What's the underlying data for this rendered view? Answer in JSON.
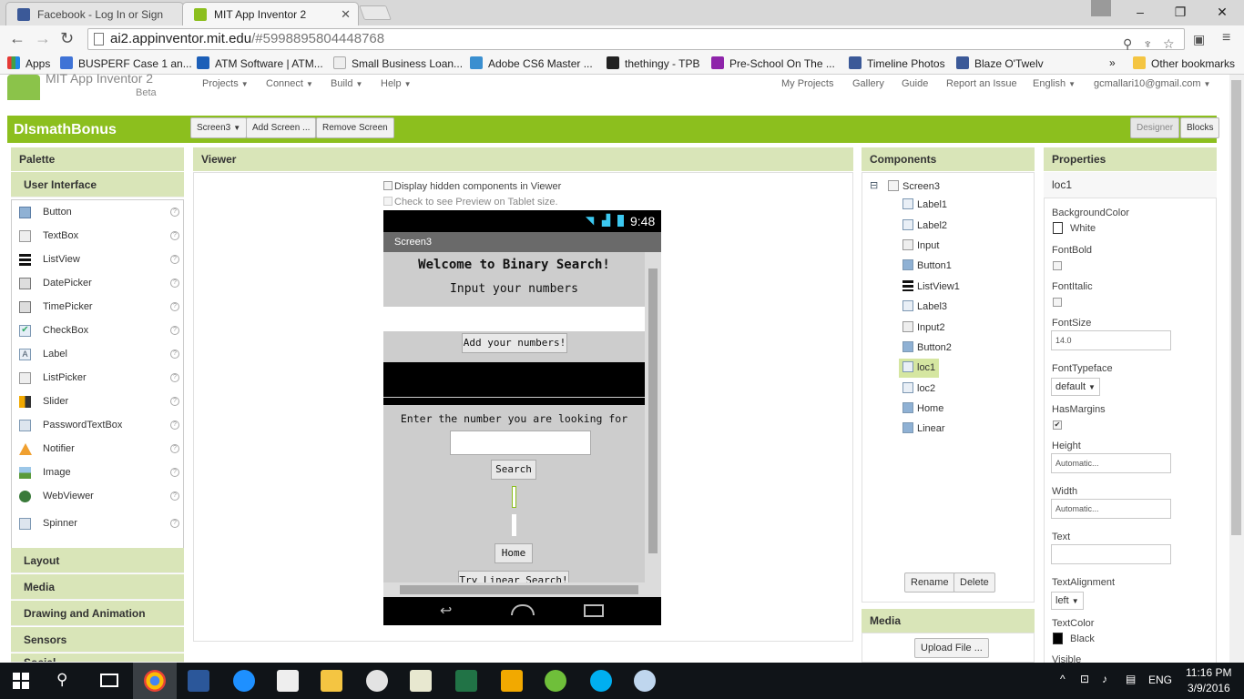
{
  "browser": {
    "tabs": [
      {
        "title": "Facebook - Log In or Sign",
        "active": false
      },
      {
        "title": "MIT App Inventor 2",
        "active": true
      }
    ],
    "url_host": "ai2.appinventor.mit.edu",
    "url_path": "/#5998895804448768",
    "bookmarks": [
      "Apps",
      "BUSPERF Case 1 an...",
      "ATM Software | ATM...",
      "Small Business Loan...",
      "Adobe CS6 Master ...",
      "thethingy - TPB",
      "Pre-School On The ...",
      "Timeline Photos",
      "Blaze O'Twelv"
    ],
    "bookmarks_overflow": "»",
    "other_bookmarks": "Other bookmarks"
  },
  "app": {
    "brand": "MIT App Inventor 2",
    "beta": "Beta",
    "menus": [
      "Projects",
      "Connect",
      "Build",
      "Help"
    ],
    "right_links": [
      "My Projects",
      "Gallery",
      "Guide",
      "Report an Issue",
      "English",
      "gcmallari10@gmail.com"
    ],
    "project_name": "DIsmathBonus",
    "screen_select": "Screen3",
    "add_screen": "Add Screen ...",
    "remove_screen": "Remove Screen",
    "designer": "Designer",
    "blocks": "Blocks",
    "accent": "#8cbf1e"
  },
  "palette": {
    "title": "Palette",
    "category": "User Interface",
    "items": [
      "Button",
      "TextBox",
      "ListView",
      "DatePicker",
      "TimePicker",
      "CheckBox",
      "Label",
      "ListPicker",
      "Slider",
      "PasswordTextBox",
      "Notifier",
      "Image",
      "WebViewer",
      "Spinner"
    ],
    "help": "?",
    "sections": [
      "Layout",
      "Media",
      "Drawing and Animation",
      "Sensors",
      "Social"
    ]
  },
  "viewer": {
    "title": "Viewer",
    "hidden_check": "Display hidden components in Viewer",
    "tablet_check": "Check to see Preview on Tablet size.",
    "time": "9:48",
    "screen_title": "Screen3",
    "welcome": "Welcome to Binary Search!",
    "input_prompt": "Input your numbers",
    "add_button": "Add your numbers!",
    "enter_prompt": "Enter the number you are looking for",
    "search_button": "Search",
    "home_button": "Home",
    "linear_button": "Try Linear Search!"
  },
  "components": {
    "title": "Components",
    "root": "Screen3",
    "collapse": "⊟",
    "items": [
      "Label1",
      "Label2",
      "Input",
      "Button1",
      "ListView1",
      "Label3",
      "Input2",
      "Button2",
      "loc1",
      "loc2",
      "Home",
      "Linear"
    ],
    "selected": "loc1",
    "rename": "Rename",
    "delete": "Delete"
  },
  "media": {
    "title": "Media",
    "upload": "Upload File ..."
  },
  "properties": {
    "title": "Properties",
    "component": "loc1",
    "background_color_label": "BackgroundColor",
    "background_color_value": "White",
    "font_bold_label": "FontBold",
    "font_italic_label": "FontItalic",
    "font_size_label": "FontSize",
    "font_size_value": "14.0",
    "font_typeface_label": "FontTypeface",
    "font_typeface_value": "default",
    "has_margins_label": "HasMargins",
    "has_margins_check": "✔",
    "height_label": "Height",
    "height_value": "Automatic...",
    "width_label": "Width",
    "width_value": "Automatic...",
    "text_label": "Text",
    "text_value": "",
    "text_alignment_label": "TextAlignment",
    "text_alignment_value": "left",
    "text_color_label": "TextColor",
    "text_color_value": "Black",
    "visible_label": "Visible"
  },
  "taskbar": {
    "language": "ENG",
    "time": "11:16 PM",
    "date": "3/9/2016"
  }
}
